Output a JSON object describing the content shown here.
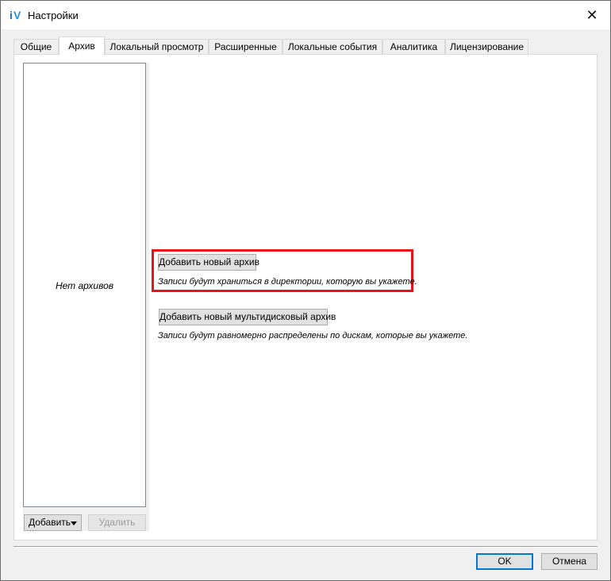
{
  "window": {
    "title": "Настройки",
    "icon": "app-logo-icon",
    "close_glyph": "✕"
  },
  "tabs": [
    {
      "label": "Общие",
      "active": false
    },
    {
      "label": "Архив",
      "active": true
    },
    {
      "label": "Локальный просмотр",
      "active": false
    },
    {
      "label": "Расширенные",
      "active": false
    },
    {
      "label": "Локальные события",
      "active": false
    },
    {
      "label": "Аналитика",
      "active": false
    },
    {
      "label": "Лицензирование",
      "active": false
    }
  ],
  "archive_list": {
    "empty_text": "Нет архивов",
    "add_label": "Добавить",
    "delete_label": "Удалить"
  },
  "main": {
    "add_archive_label": "Добавить новый архив",
    "add_archive_hint": "Записи будут храниться в директории, которую вы укажете.",
    "add_multi_label": "Добавить новый мультидисковый архив",
    "add_multi_hint": "Записи будут равномерно распределены по дискам, которые вы укажете.",
    "highlight_color": "#e8131b"
  },
  "footer": {
    "ok_label": "OK",
    "cancel_label": "Отмена"
  }
}
